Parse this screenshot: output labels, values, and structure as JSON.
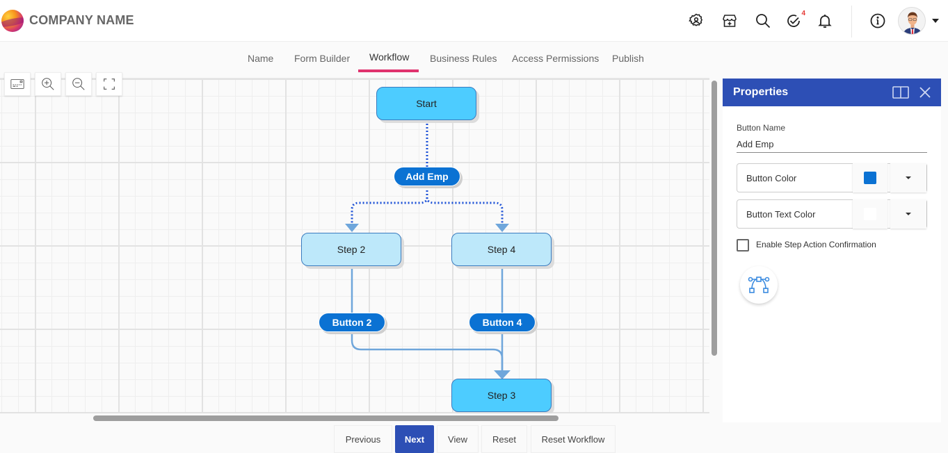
{
  "header": {
    "brand": "COMPANY NAME",
    "icons": [
      {
        "name": "user-settings-icon"
      },
      {
        "name": "store-add-icon"
      },
      {
        "name": "search-icon"
      },
      {
        "name": "tasks-check-icon",
        "badge": "4"
      },
      {
        "name": "bell-icon"
      },
      {
        "name": "info-icon"
      }
    ],
    "badge_color": "#e53935"
  },
  "tabs": [
    {
      "label": "Name",
      "active": false
    },
    {
      "label": "Form Builder",
      "active": false
    },
    {
      "label": "Workflow",
      "active": true
    },
    {
      "label": "Business Rules",
      "active": false
    },
    {
      "label": "Access Permissions",
      "active": false
    },
    {
      "label": "Publish",
      "active": false
    }
  ],
  "toolbar": [
    "keyboard-icon",
    "zoom-in-icon",
    "zoom-out-icon",
    "fit-screen-icon"
  ],
  "workflow": {
    "nodes": [
      {
        "id": "start",
        "label": "Start",
        "style": "dark"
      },
      {
        "id": "step2",
        "label": "Step 2",
        "style": "light"
      },
      {
        "id": "step4",
        "label": "Step 4",
        "style": "light"
      },
      {
        "id": "step3",
        "label": "Step 3",
        "style": "dark"
      }
    ],
    "buttons": [
      {
        "id": "addemp",
        "label": "Add Emp",
        "selected": true
      },
      {
        "id": "button2",
        "label": "Button 2",
        "selected": false
      },
      {
        "id": "button4",
        "label": "Button 4",
        "selected": false
      }
    ],
    "edges": [
      {
        "from": "start",
        "via": "addemp",
        "to": "step2",
        "style": "dotted"
      },
      {
        "from": "start",
        "via": "addemp",
        "to": "step4",
        "style": "dotted"
      },
      {
        "from": "step2",
        "via": "button2",
        "to": "step3",
        "style": "solid"
      },
      {
        "from": "step4",
        "via": "button4",
        "to": "step3",
        "style": "solid"
      }
    ],
    "colors": {
      "node_dark": "#4dccff",
      "node_light": "#bde8fa",
      "button": "#0b72d3",
      "edge_selected": "#1a4fd6",
      "edge": "#6fa6db"
    }
  },
  "properties": {
    "title": "Properties",
    "button_name_label": "Button Name",
    "button_name_value": "Add Emp",
    "button_color_label": "Button Color",
    "button_color_value": "#0b72d3",
    "button_text_color_label": "Button Text Color",
    "button_text_color_value": "#ffffff",
    "confirm_label": "Enable Step Action Confirmation",
    "confirm_checked": false
  },
  "footer": {
    "previous": "Previous",
    "next": "Next",
    "view": "View",
    "reset": "Reset",
    "reset_workflow": "Reset Workflow"
  }
}
